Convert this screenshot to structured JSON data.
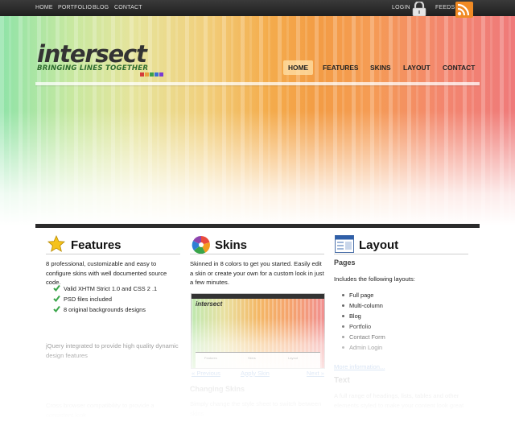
{
  "topbar": {
    "links": [
      "Home",
      "Portfolio",
      "Blog",
      "Contact"
    ],
    "login": "Login",
    "feeds": "Feeds"
  },
  "logo": {
    "word": "intersect",
    "tagline": "BRINGING LINES TOGETHER",
    "square_colors": [
      "#d43b3b",
      "#e8a13a",
      "#3b9e4a",
      "#3b6fd4",
      "#7a3bd4"
    ]
  },
  "nav": {
    "items": [
      "Home",
      "Features",
      "Skins",
      "Layout",
      "Contact"
    ],
    "active": "Home"
  },
  "features": {
    "title": "Features",
    "intro": "8 professional, customizable and easy to configure skins with well documented source code.",
    "checks": [
      "Valid XHTM Strict 1.0 and CSS 2 .1",
      "PSD files included",
      "8 original backgrounds designs"
    ],
    "jquery": "jQuery integrated to provide high quality dynamic design features",
    "cross": "Cross browser compatibility to provide a consistent look"
  },
  "skins": {
    "title": "Skins",
    "intro": "Skinned in 8 colors to get you started. Easily edit a skin or create your own for a custom look in just a few minutes.",
    "thumb_logo": "intersect",
    "thumb_labels": [
      "Features",
      "Skins",
      "Layout"
    ],
    "prev": "« Previous",
    "apply": "Apply Skin",
    "next": "Next »",
    "changing": "Changing Skins",
    "changing_text": "Simply change the style sheet to switch between skins"
  },
  "layout": {
    "title": "Layout",
    "pages_heading": "Pages",
    "includes": "Includes the following layouts:",
    "pages": [
      "Full page",
      "Multi-column",
      "Blog",
      "Portfolio",
      "Contact Form",
      "Admin Login"
    ],
    "more": "More information...",
    "text_heading": "Text",
    "text_body": "A full range of headings, lists, tables and other elements styled to make your content look great"
  },
  "colors": {
    "topbar": "#2a2a2a",
    "accent_green": "#3aa54a",
    "link": "#6d9ad6"
  }
}
